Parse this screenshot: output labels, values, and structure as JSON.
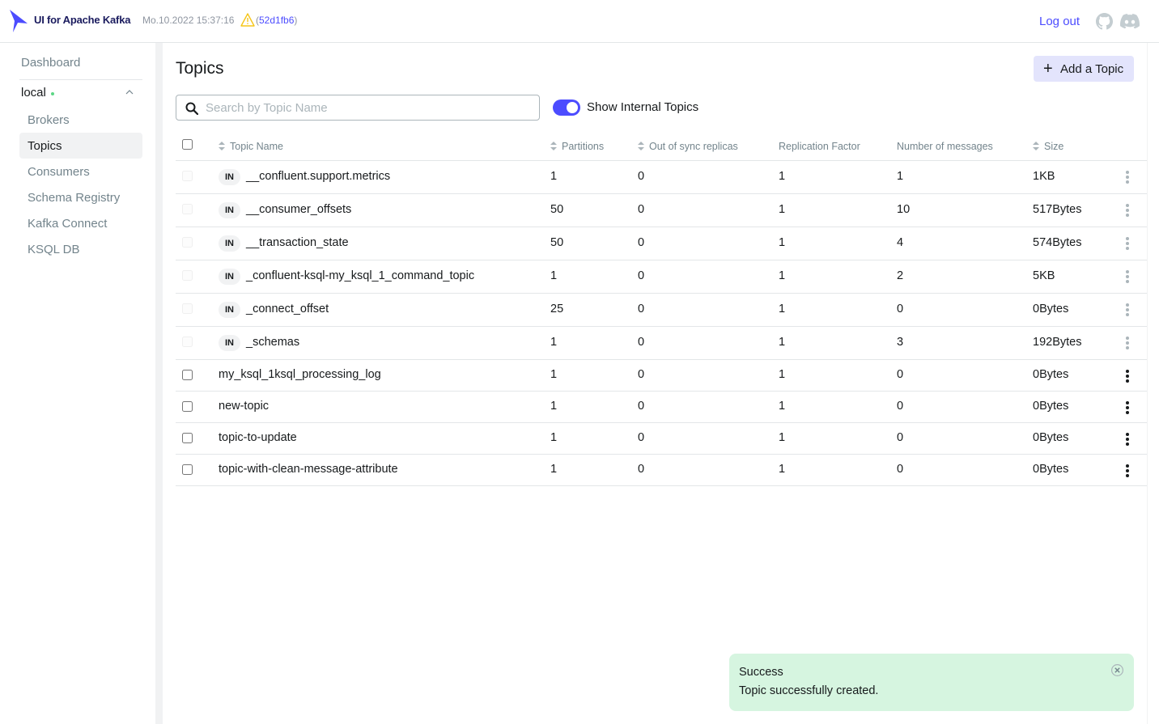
{
  "header": {
    "brand": "UI for Apache Kafka",
    "build_date": "Mo.10.2022 15:37:16",
    "commit_open": "(",
    "commit_hash": "52d1fb6",
    "commit_close": ")",
    "logout": "Log out",
    "icons": [
      "kafka-logo",
      "warning-icon",
      "github-icon",
      "discord-icon"
    ]
  },
  "sidebar": {
    "dashboard": "Dashboard",
    "cluster": "local",
    "items": [
      {
        "label": "Brokers"
      },
      {
        "label": "Topics",
        "active": true
      },
      {
        "label": "Consumers"
      },
      {
        "label": "Schema Registry"
      },
      {
        "label": "Kafka Connect"
      },
      {
        "label": "KSQL DB"
      }
    ]
  },
  "main": {
    "title": "Topics",
    "add_button": "Add a Topic",
    "search_placeholder": "Search by Topic Name",
    "toggle_label": "Show Internal Topics",
    "toggle_on": true
  },
  "table": {
    "columns": [
      "Topic Name",
      "Partitions",
      "Out of sync replicas",
      "Replication Factor",
      "Number of messages",
      "Size"
    ],
    "rows": [
      {
        "internal": true,
        "badge": "IN",
        "name": "__confluent.support.metrics",
        "partitions": "1",
        "out_of_sync": "0",
        "replication": "1",
        "messages": "1",
        "size": "1KB"
      },
      {
        "internal": true,
        "badge": "IN",
        "name": "__consumer_offsets",
        "partitions": "50",
        "out_of_sync": "0",
        "replication": "1",
        "messages": "10",
        "size": "517Bytes"
      },
      {
        "internal": true,
        "badge": "IN",
        "name": "__transaction_state",
        "partitions": "50",
        "out_of_sync": "0",
        "replication": "1",
        "messages": "4",
        "size": "574Bytes"
      },
      {
        "internal": true,
        "badge": "IN",
        "name": "_confluent-ksql-my_ksql_1_command_topic",
        "partitions": "1",
        "out_of_sync": "0",
        "replication": "1",
        "messages": "2",
        "size": "5KB"
      },
      {
        "internal": true,
        "badge": "IN",
        "name": "_connect_offset",
        "partitions": "25",
        "out_of_sync": "0",
        "replication": "1",
        "messages": "0",
        "size": "0Bytes"
      },
      {
        "internal": true,
        "badge": "IN",
        "name": "_schemas",
        "partitions": "1",
        "out_of_sync": "0",
        "replication": "1",
        "messages": "3",
        "size": "192Bytes"
      },
      {
        "internal": false,
        "badge": "",
        "name": "my_ksql_1ksql_processing_log",
        "partitions": "1",
        "out_of_sync": "0",
        "replication": "1",
        "messages": "0",
        "size": "0Bytes"
      },
      {
        "internal": false,
        "badge": "",
        "name": "new-topic",
        "partitions": "1",
        "out_of_sync": "0",
        "replication": "1",
        "messages": "0",
        "size": "0Bytes"
      },
      {
        "internal": false,
        "badge": "",
        "name": "topic-to-update",
        "partitions": "1",
        "out_of_sync": "0",
        "replication": "1",
        "messages": "0",
        "size": "0Bytes"
      },
      {
        "internal": false,
        "badge": "",
        "name": "topic-with-clean-message-attribute",
        "partitions": "1",
        "out_of_sync": "0",
        "replication": "1",
        "messages": "0",
        "size": "0Bytes"
      }
    ]
  },
  "toast": {
    "title": "Success",
    "message": "Topic successfully created."
  },
  "colors": {
    "accent": "#4c4cff",
    "toast_bg": "#d6f5e0",
    "status_online": "#5cd685"
  }
}
